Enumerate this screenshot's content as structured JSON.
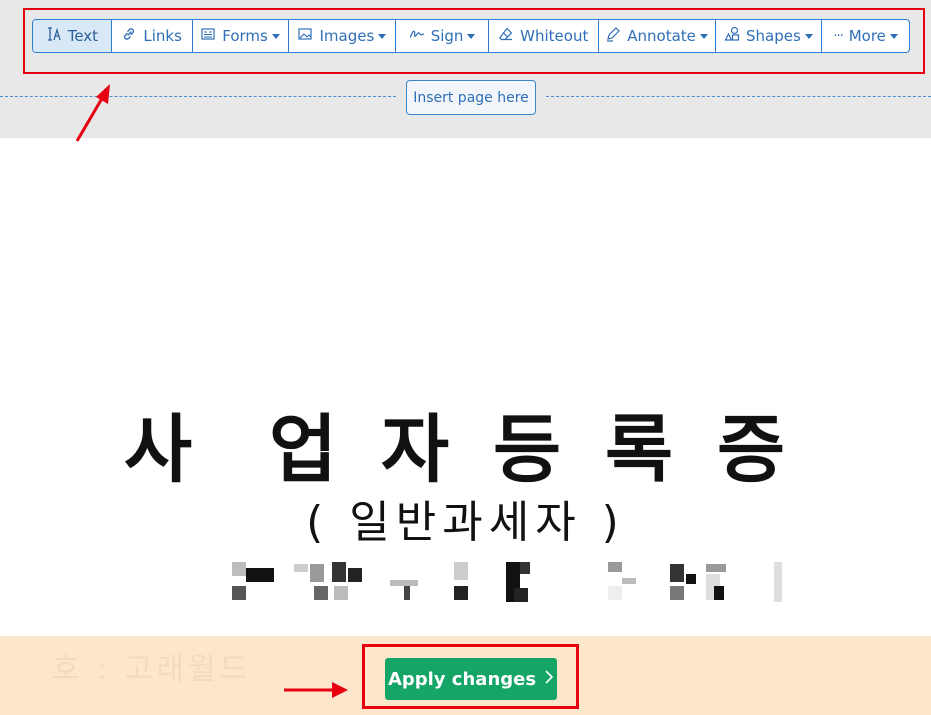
{
  "toolbar": {
    "items": [
      {
        "label": "Text",
        "icon": "text-cursor-icon",
        "dropdown": false,
        "active": true
      },
      {
        "label": "Links",
        "icon": "link-icon",
        "dropdown": false,
        "active": false
      },
      {
        "label": "Forms",
        "icon": "form-icon",
        "dropdown": true,
        "active": false
      },
      {
        "label": "Images",
        "icon": "image-icon",
        "dropdown": true,
        "active": false
      },
      {
        "label": "Sign",
        "icon": "signature-icon",
        "dropdown": true,
        "active": false
      },
      {
        "label": "Whiteout",
        "icon": "eraser-icon",
        "dropdown": false,
        "active": false
      },
      {
        "label": "Annotate",
        "icon": "marker-icon",
        "dropdown": true,
        "active": false
      },
      {
        "label": "Shapes",
        "icon": "shapes-icon",
        "dropdown": true,
        "active": false
      },
      {
        "label": "More",
        "icon": "ellipsis-icon",
        "dropdown": true,
        "active": false
      }
    ]
  },
  "insert_page_label": "Insert page here",
  "document": {
    "title_chars": [
      "사",
      "업",
      "자",
      "등",
      "록",
      "증"
    ],
    "subtitle": "( 일반과세자 )",
    "faded_text": "호 : 고래월드"
  },
  "apply_button": {
    "label": "Apply changes",
    "icon": "chevron-right-icon"
  },
  "colors": {
    "accent": "#2f7fd1",
    "apply_green": "#14a567",
    "annotation_red": "#e60012",
    "bottom_bar": "#fde7cc",
    "top_band": "#e8e8e8"
  }
}
